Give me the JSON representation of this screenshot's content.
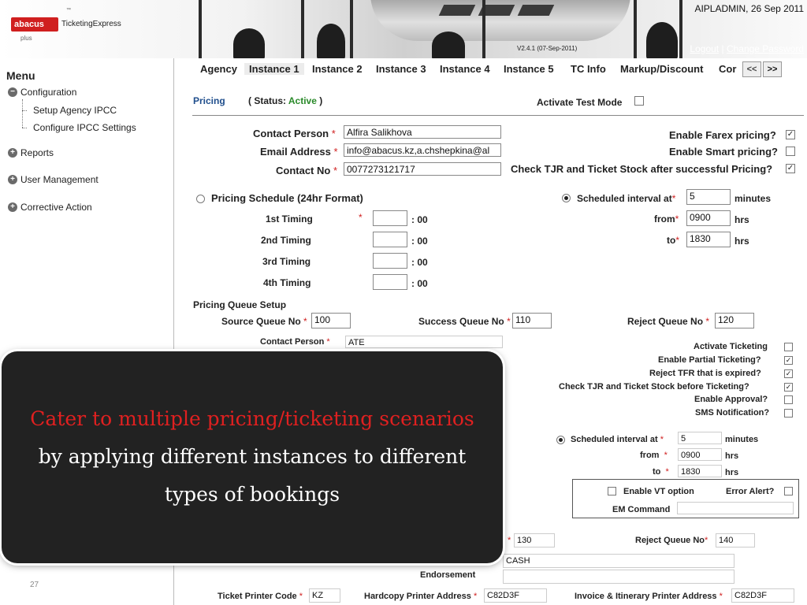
{
  "header": {
    "logo_brand": "abacus",
    "logo_product": "TicketingExpress",
    "logo_tm": "™",
    "logo_plus": "plus",
    "user_stamp": "AIPLADMIN, 26 Sep 2011",
    "version": "V2.4.1 (07-Sep-2011)",
    "logout": "Logout",
    "link_sep": "|",
    "change_password": "Change Password"
  },
  "sidebar": {
    "title": "Menu",
    "items": [
      {
        "label": "Configuration",
        "icon": "minus-circle-icon",
        "glyph": "−"
      },
      {
        "label": "Reports",
        "icon": "plus-circle-icon",
        "glyph": "+"
      },
      {
        "label": "User Management",
        "icon": "plus-circle-icon",
        "glyph": "+"
      },
      {
        "label": "Corrective Action",
        "icon": "plus-circle-icon",
        "glyph": "+"
      }
    ],
    "sub_items": [
      "Setup Agency IPCC",
      "Configure IPCC Settings"
    ]
  },
  "tabs": [
    "Agency",
    "Instance 1",
    "Instance 2",
    "Instance 3",
    "Instance 4",
    "Instance 5",
    "TC Info",
    "Markup/Discount",
    "Cor"
  ],
  "tab_nav": {
    "prev": "<<",
    "next": ">>"
  },
  "pricing": {
    "title": "Pricing",
    "status_prefix": "( Status:",
    "status_value": "Active",
    "status_suffix": ")",
    "status_color": "#2a8a2a",
    "test_mode_label": "Activate Test Mode",
    "contact_person_label": "Contact Person",
    "contact_person_value": "Alfira Salikhova",
    "email_label": "Email Address",
    "email_value": "info@abacus.kz,a.chshepkina@al",
    "contact_no_label": "Contact No",
    "contact_no_value": "0077273121717",
    "farex_label": "Enable Farex pricing?",
    "smart_label": "Enable Smart pricing?",
    "tjr_label": "Check TJR and Ticket Stock after successful Pricing?",
    "schedule_label": "Pricing Schedule (24hr Format)",
    "timings": [
      "1st Timing",
      "2nd Timing",
      "3rd Timing",
      "4th Timing"
    ],
    "timing_suffix": ": 00",
    "interval_label": "Scheduled interval at",
    "interval_value": "5",
    "interval_unit": "minutes",
    "from_label": "from",
    "from_value": "0900",
    "to_label": "to",
    "to_value": "1830",
    "hrs": "hrs",
    "queue_title": "Pricing Queue Setup",
    "source_label": "Source Queue No",
    "source_value": "100",
    "success_label": "Success Queue No",
    "success_value": "110",
    "reject_label": "Reject Queue No",
    "reject_value": "120"
  },
  "ticketing": {
    "contact_person_label": "Contact Person",
    "contact_person_value": "ATE",
    "activate_label": "Activate Ticketing",
    "partial_label": "Enable Partial Ticketing?",
    "reject_tfr_label": "Reject TFR that is expired?",
    "tjr_label": "Check TJR and Ticket Stock before Ticketing?",
    "approval_label": "Enable Approval?",
    "sms_label": "SMS Notification?",
    "interval_label": "Scheduled interval at",
    "interval_value": "5",
    "interval_unit": "minutes",
    "from_label": "from",
    "from_value": "0900",
    "to_label": "to",
    "to_value": "1830",
    "hrs": "hrs",
    "vt_label": "Enable VT option",
    "error_alert_label": "Error Alert?",
    "em_command_label": "EM Command",
    "success_value": "130",
    "reject_label": "Reject Queue No",
    "reject_value": "140",
    "payment_value": "CASH",
    "endorsement_label": "Endorsement",
    "ticket_printer_label": "Ticket Printer Code",
    "ticket_printer_value": "KZ",
    "hardcopy_label": "Hardcopy Printer Address",
    "hardcopy_value": "C82D3F",
    "invoice_label": "Invoice & Itinerary Printer Address",
    "invoice_value": "C82D3F"
  },
  "overlay": {
    "highlight": "Cater to multiple pricing/ticketing scenarios",
    "rest": " by applying different instances to different types of bookings",
    "highlight_color": "#e02020",
    "background": "#222222"
  },
  "slide_number": "27",
  "required_mark": "*",
  "check_mark": "✓"
}
